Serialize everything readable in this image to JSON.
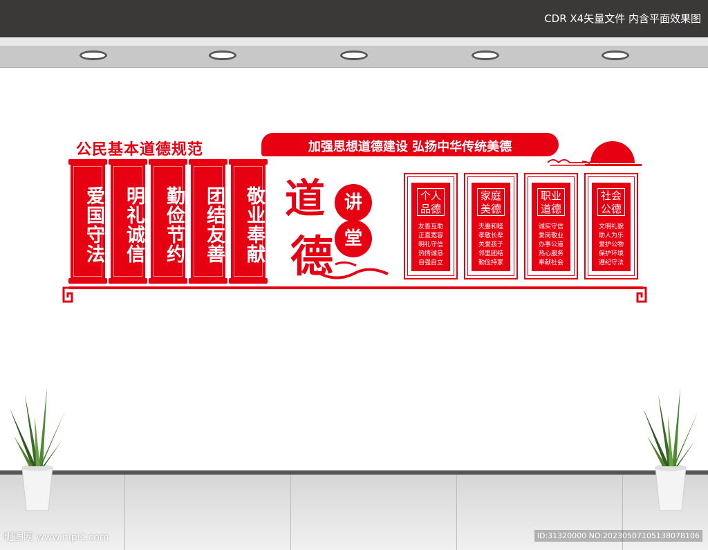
{
  "header": {
    "caption": "CDR X4矢量文件  内含平面效果图"
  },
  "left_section": {
    "title": "公民基本道德规范",
    "panels": [
      {
        "text": "爱国守法"
      },
      {
        "text": "明礼诚信"
      },
      {
        "text": "勤俭节约"
      },
      {
        "text": "团结友善"
      },
      {
        "text": "敬业奉献"
      }
    ]
  },
  "slogan": "加强思想道德建设  弘扬中华传统美德",
  "center": {
    "big_chars": [
      "道",
      "德"
    ],
    "circle_chars": [
      "讲",
      "堂"
    ]
  },
  "boards": [
    {
      "title": "个人品德",
      "lines": [
        "友善互助",
        "正直宽容",
        "明礼守信",
        "热情诚恳",
        "自强自立"
      ]
    },
    {
      "title": "家庭美德",
      "lines": [
        "夫妻和睦",
        "孝敬长辈",
        "关爱孩子",
        "邻里团结",
        "勤俭持家"
      ]
    },
    {
      "title": "职业道德",
      "lines": [
        "诚实守信",
        "爱岗敬业",
        "办事公道",
        "热心服务",
        "奉献社会"
      ]
    },
    {
      "title": "社会公德",
      "lines": [
        "文明礼貌",
        "助人为乐",
        "爱护公物",
        "保护环境",
        "遵纪守法"
      ]
    }
  ],
  "watermark": {
    "left": "昵图网 www.nipic.com",
    "right": "ID:31320000 NO:20230507105138078106"
  },
  "colors": {
    "accent_red": "#e60012",
    "top_bar": "#3b3838",
    "ceiling": "#c8c8c8"
  },
  "icons": {
    "sun": "rising-sun-icon",
    "plant": "snake-plant-icon",
    "lamp": "ceiling-lamp-icon"
  }
}
